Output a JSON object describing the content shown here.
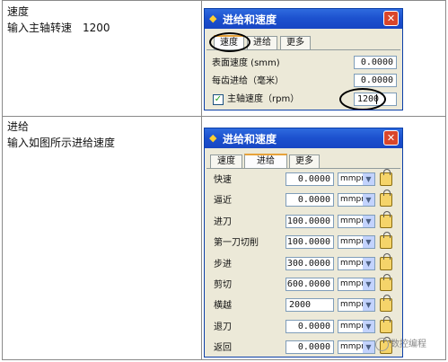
{
  "row1": {
    "title": "速度",
    "instruction": "输入主轴转速　1200"
  },
  "row2": {
    "title": "进给",
    "instruction": "输入如图所示进给速度"
  },
  "dialog1": {
    "title": "进给和速度",
    "tabs": [
      "速度",
      "进给",
      "更多"
    ],
    "active_tab": "速度",
    "fields": [
      {
        "label": "表面速度 (smm)",
        "value": "0.0000"
      },
      {
        "label": "每齿进给（毫米）",
        "value": "0.0000"
      }
    ],
    "spindle": {
      "label": "主轴速度（rpm）",
      "value": "1200",
      "checked": true
    }
  },
  "dialog2": {
    "title": "进给和速度",
    "tabs": [
      "速度",
      "进给",
      "更多"
    ],
    "active_tab": "进给",
    "rows": [
      {
        "label": "快速",
        "value": "0.0000",
        "unit": "mmpm"
      },
      {
        "label": "逼近",
        "value": "0.0000",
        "unit": "mmpm"
      },
      {
        "label": "进刀",
        "value": "100.0000",
        "unit": "mmpm"
      },
      {
        "label": "第一刀切削",
        "value": "100.0000",
        "unit": "mmpm"
      },
      {
        "label": "步进",
        "value": "300.0000",
        "unit": "mmpm"
      },
      {
        "label": "剪切",
        "value": "600.0000",
        "unit": "mmpm"
      },
      {
        "label": "横越",
        "value": "2000",
        "unit": "mmpm"
      },
      {
        "label": "退刀",
        "value": "0.0000",
        "unit": "mmpm"
      },
      {
        "label": "返回",
        "value": "0.0000",
        "unit": "mmpm"
      }
    ]
  },
  "watermark": {
    "text": "数控编程"
  },
  "colors": {
    "title_bar": "#1d52cf",
    "dialog_bg": "#ece9d8",
    "close_button": "#d9462b",
    "tab_highlight": "#e8a33a"
  }
}
